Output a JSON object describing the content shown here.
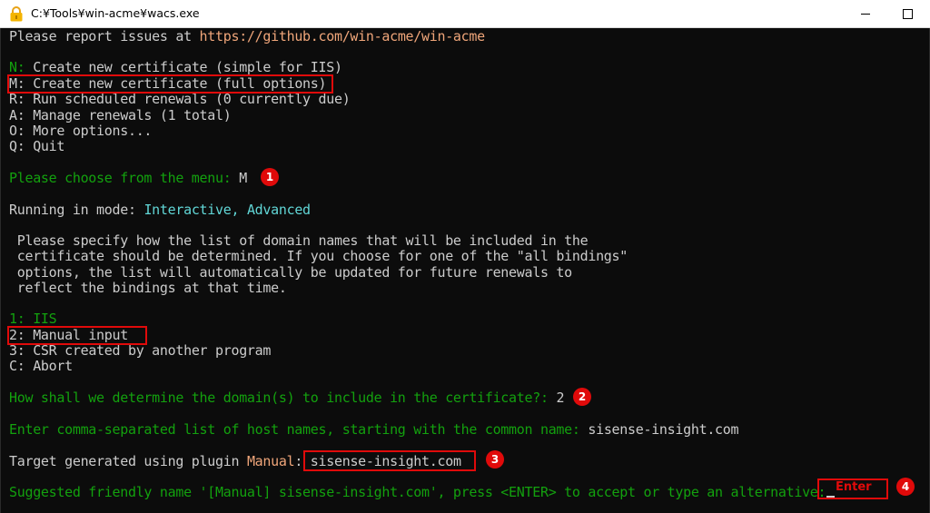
{
  "window": {
    "title": "C:¥Tools¥win-acme¥wacs.exe",
    "icon": "lock-icon"
  },
  "console": {
    "report_prefix": "Please report issues at ",
    "report_url": "https://github.com/win-acme/win-acme",
    "menu": [
      {
        "key": "N:",
        "text": " Create new certificate (simple for IIS)"
      },
      {
        "key": "M:",
        "text": " Create new certificate (full options)"
      },
      {
        "key": "R:",
        "text": " Run scheduled renewals (0 currently due)"
      },
      {
        "key": "A:",
        "text": " Manage renewals (1 total)"
      },
      {
        "key": "O:",
        "text": " More options..."
      },
      {
        "key": "Q:",
        "text": " Quit"
      }
    ],
    "choose_prompt": "Please choose from the menu: ",
    "choose_answer": "M",
    "mode_prefix": "Running in mode: ",
    "mode_value": "Interactive, Advanced",
    "paragraph": [
      " Please specify how the list of domain names that will be included in the",
      " certificate should be determined. If you choose for one of the \"all bindings\"",
      " options, the list will automatically be updated for future renewals to",
      " reflect the bindings at that time."
    ],
    "source_options": [
      {
        "key": "1:",
        "text": " IIS"
      },
      {
        "key": "2:",
        "text": " Manual input"
      },
      {
        "key": "3:",
        "text": " CSR created by another program"
      },
      {
        "key": "C:",
        "text": " Abort"
      }
    ],
    "determine_prompt": "How shall we determine the domain(s) to include in the certificate?: ",
    "determine_answer": "2",
    "hostnames_prompt": "Enter comma-separated list of host names, starting with the common name: ",
    "hostnames_answer": "sisense-insight.com",
    "target_prefix": "Target generated using plugin ",
    "target_plugin": "Manual",
    "target_sep": ": ",
    "target_value": "sisense-insight.com",
    "friendly_prompt": "Suggested friendly name '[Manual] sisense-insight.com', press <ENTER> to accept or type an alternative: "
  },
  "annotations": {
    "enter_label": "Enter",
    "steps": [
      "1",
      "2",
      "3",
      "4"
    ],
    "highlight_color": "#e00a0a"
  }
}
